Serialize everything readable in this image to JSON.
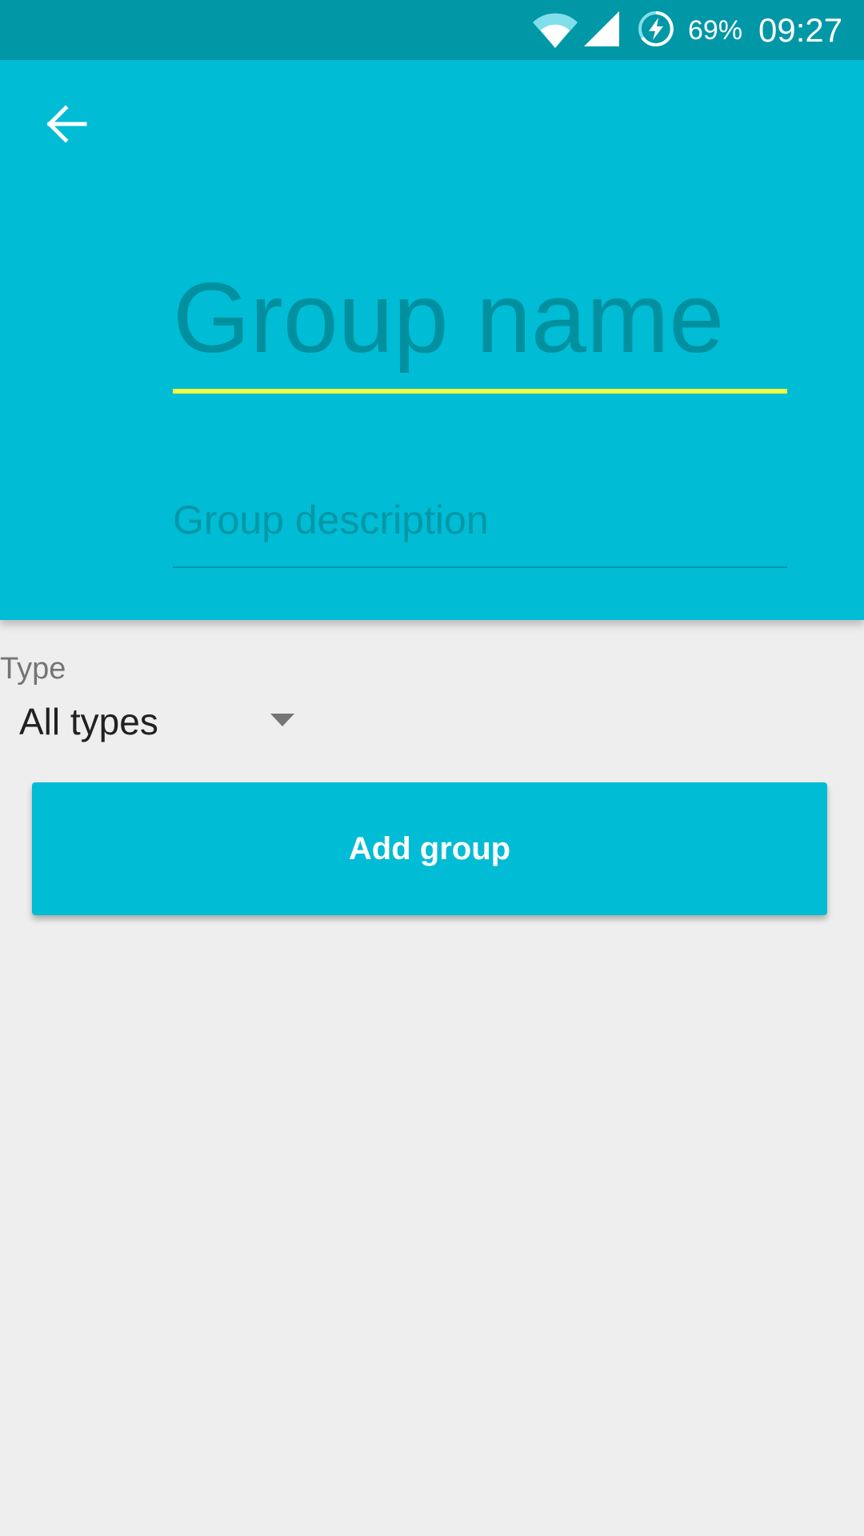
{
  "status_bar": {
    "battery_percent": "69%",
    "time": "09:27",
    "icons": [
      "wifi-icon",
      "signal-icon",
      "battery-charging-icon"
    ]
  },
  "header": {
    "back_icon": "arrow-left-icon",
    "group_name_placeholder": "Group name",
    "group_description_placeholder": "Group description"
  },
  "type_selector": {
    "label": "Type",
    "selected": "All types",
    "arrow_icon": "dropdown-arrow-icon"
  },
  "actions": {
    "add_group_label": "Add group"
  },
  "colors": {
    "primary": "#00bcd4",
    "primary_dark": "#0097a7",
    "accent": "#eeff41",
    "background": "#eeeeee"
  }
}
